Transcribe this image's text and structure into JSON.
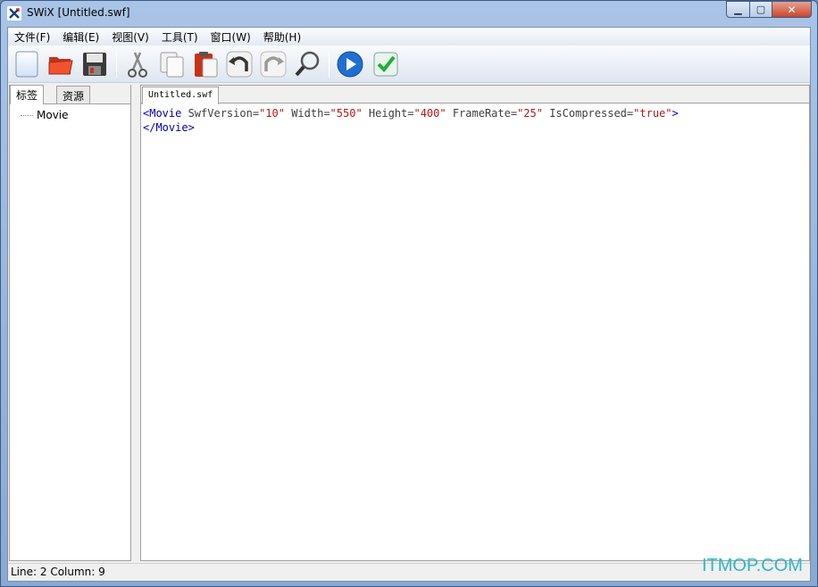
{
  "window": {
    "title": "SWiX [Untitled.swf]"
  },
  "menu": [
    {
      "label": "文件(F)"
    },
    {
      "label": "编辑(E)"
    },
    {
      "label": "视图(V)"
    },
    {
      "label": "工具(T)"
    },
    {
      "label": "窗口(W)"
    },
    {
      "label": "帮助(H)"
    }
  ],
  "toolbar": {
    "buttons": [
      "new-file-icon",
      "open-folder-icon",
      "save-icon",
      "cut-icon",
      "copy-icon",
      "paste-icon",
      "undo-icon",
      "redo-icon",
      "find-icon",
      "play-icon",
      "check-icon"
    ]
  },
  "left_panel": {
    "tabs": [
      {
        "label": "标签"
      },
      {
        "label": "资源"
      }
    ],
    "tree": [
      {
        "label": "Movie"
      }
    ]
  },
  "editor": {
    "tab": "Untitled.swf",
    "line1": {
      "open": "<",
      "tag": "Movie",
      "attrs": [
        {
          "name": " SwfVersion=",
          "value": "\"10\""
        },
        {
          "name": " Width=",
          "value": "\"550\""
        },
        {
          "name": " Height=",
          "value": "\"400\""
        },
        {
          "name": " FrameRate=",
          "value": "\"25\""
        },
        {
          "name": " IsCompressed=",
          "value": "\"true\""
        }
      ],
      "close": ">"
    },
    "line2": {
      "open": "</",
      "tag": "Movie",
      "close": ">"
    }
  },
  "status": {
    "text": "Line: 2 Column: 9"
  },
  "watermark": "ITMOP.COM"
}
